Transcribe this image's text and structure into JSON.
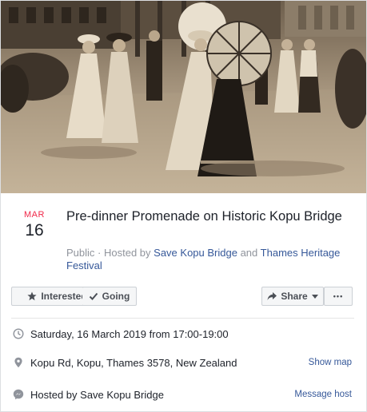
{
  "event": {
    "month": "MAR",
    "day": "16",
    "title": "Pre-dinner Promenade on Historic Kopu Bridge",
    "privacy": "Public",
    "hosted_by_prefix": "· Hosted by",
    "host_one": "Save Kopu Bridge",
    "and_text": "and",
    "host_two": "Thames Heritage Festival"
  },
  "actions": {
    "interested": "Interested",
    "going": "Going",
    "share": "Share",
    "more": "•••"
  },
  "details": {
    "datetime": "Saturday, 16 March 2019 from 17:00-19:00",
    "location": "Kopu Rd, Kopu, Thames 3578, New Zealand",
    "show_map": "Show map",
    "hosted": "Hosted by Save Kopu Bridge",
    "message_host": "Message host"
  },
  "colors": {
    "month_red": "#f02849",
    "link_blue": "#365899",
    "muted_gray": "#90949c",
    "photo_sepia": "#b8a58c"
  },
  "icons": [
    "star-icon",
    "check-icon",
    "share-arrow-icon",
    "caret-down-icon",
    "clock-icon",
    "map-pin-icon",
    "messenger-icon"
  ]
}
